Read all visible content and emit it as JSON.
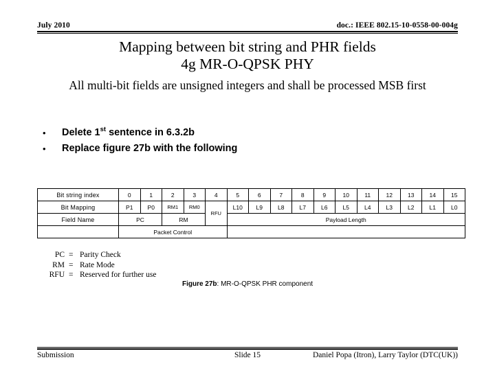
{
  "header": {
    "left": "July 2010",
    "right": "doc.: IEEE 802.15-10-0558-00-004g"
  },
  "title": {
    "line1": "Mapping between bit string and PHR fields",
    "line2": "4g MR-O-QPSK PHY",
    "subtitle": "All multi-bit fields are unsigned integers and shall be processed MSB first"
  },
  "bullets": [
    {
      "marker": "•",
      "text_before": "Delete 1",
      "sup": "st",
      "text_after": " sentence in 6.3.2b"
    },
    {
      "marker": "•",
      "text_before": "Replace figure 27b with the following",
      "sup": "",
      "text_after": ""
    }
  ],
  "figure_table": {
    "row_labels": {
      "bit_string_index": "Bit string index",
      "bit_mapping": "Bit Mapping",
      "field_name": "Field Name",
      "blank": ""
    },
    "bit_string_index": [
      "0",
      "1",
      "2",
      "3",
      "4",
      "5",
      "6",
      "7",
      "8",
      "9",
      "10",
      "11",
      "12",
      "13",
      "14",
      "15"
    ],
    "bit_mapping": [
      "P1",
      "P0",
      "RM1",
      "RM0",
      "",
      "L10",
      "L9",
      "L8",
      "L7",
      "L6",
      "L5",
      "L4",
      "L3",
      "L2",
      "L1",
      "L0"
    ],
    "field_name_groups": [
      {
        "label": "PC",
        "span": 2
      },
      {
        "label": "RM",
        "span": 2
      },
      {
        "label": "RFU",
        "span": 1
      },
      {
        "label": "Payload Length",
        "span": 11
      }
    ],
    "rfu_label": "RFU",
    "bottom_groups": [
      {
        "label": "Packet Control",
        "span": 5
      },
      {
        "label": "",
        "span": 11
      }
    ]
  },
  "legend": [
    {
      "abbr": "PC",
      "eq": "=",
      "desc": "Parity Check"
    },
    {
      "abbr": "RM",
      "eq": "=",
      "desc": "Rate Mode"
    },
    {
      "abbr": "RFU",
      "eq": "=",
      "desc": "Reserved for further use"
    }
  ],
  "figure_caption": {
    "bold": "Figure 27b",
    "rest": ": MR-O-QPSK PHR component"
  },
  "footer": {
    "left": "Submission",
    "center": "Slide 15",
    "right": "Daniel Popa (Itron), Larry Taylor (DTC(UK))"
  },
  "colors": {
    "background": "#ffffff",
    "text": "#000000",
    "rule": "#000000",
    "table_border": "#000000"
  }
}
